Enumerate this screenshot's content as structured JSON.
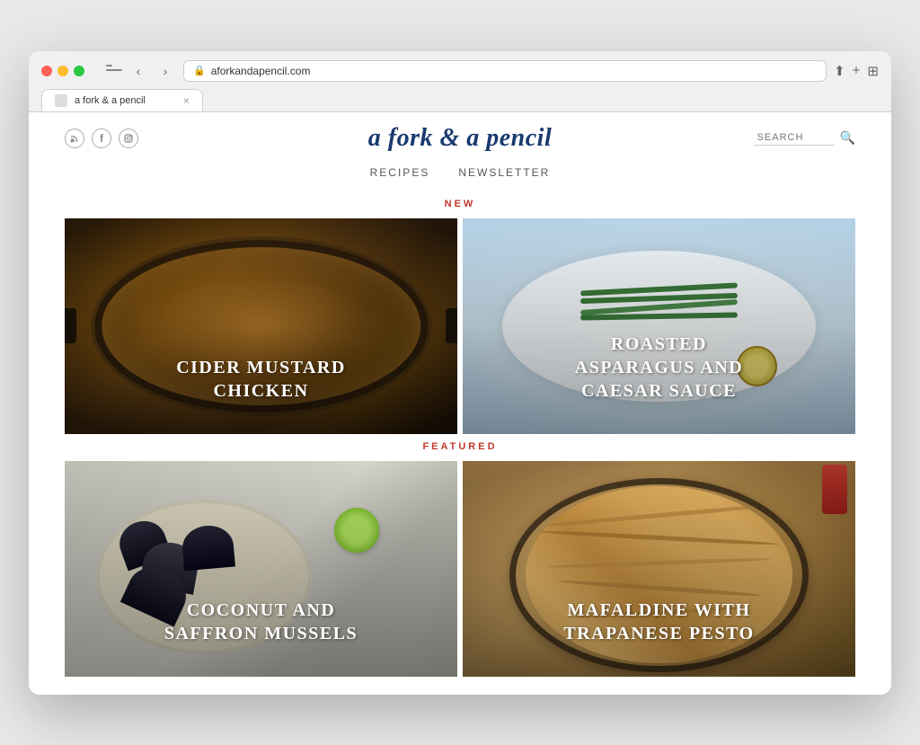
{
  "browser": {
    "url": "aforkandapencil.com",
    "tab_title": "a fork & a pencil",
    "close_label": "×"
  },
  "site": {
    "title": "a fork & a pencil",
    "search_placeholder": "SEARCH",
    "nav": [
      {
        "label": "RECIPES",
        "id": "nav-recipes"
      },
      {
        "label": "NEWSLETTER",
        "id": "nav-newsletter"
      }
    ],
    "sections": [
      {
        "id": "new",
        "label": "NEW",
        "recipes": [
          {
            "id": "cider-chicken",
            "title": "CIDER MUSTARD\nCHICKEN",
            "theme": "chicken"
          },
          {
            "id": "asparagus",
            "title": "ROASTED\nASPARAGUS AND\nCAESAR SAUCE",
            "theme": "asparagus"
          }
        ]
      },
      {
        "id": "featured",
        "label": "FEATURED",
        "recipes": [
          {
            "id": "mussels",
            "title": "COCONUT AND\nSAFFRON MUSSELS",
            "theme": "mussels"
          },
          {
            "id": "pasta",
            "title": "MAFALDINE WITH\nTRAPANESE PESTO",
            "theme": "pasta"
          }
        ]
      }
    ],
    "social": [
      {
        "icon": "rss",
        "label": "RSS"
      },
      {
        "icon": "f",
        "label": "Facebook"
      },
      {
        "icon": "at",
        "label": "Instagram"
      }
    ]
  }
}
